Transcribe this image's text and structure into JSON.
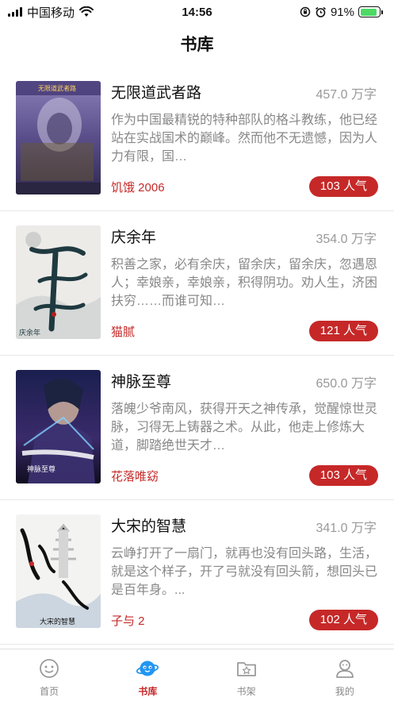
{
  "status_bar": {
    "carrier": "中国移动",
    "time": "14:56",
    "battery": "91%"
  },
  "header": {
    "title": "书库"
  },
  "books": [
    {
      "title": "无限道武者路",
      "words": "457.0 万字",
      "description": "作为中国最精锐的特种部队的格斗教练，他已经站在实战国术的巅峰。然而他不无遗憾，因为人力有限，国…",
      "author": "饥饿 2006",
      "popularity": "103 人气",
      "cover_text": "无限道武者路"
    },
    {
      "title": "庆余年",
      "words": "354.0 万字",
      "description": "积善之家，必有余庆，留余庆，留余庆，忽遇恩人；幸娘亲，幸娘亲，积得阴功。劝人生，济困扶穷……而谁可知…",
      "author": "猫腻",
      "popularity": "121 人气",
      "cover_text": "庆余年"
    },
    {
      "title": "神脉至尊",
      "words": "650.0 万字",
      "description": "落魄少爷南风，获得开天之神传承，觉醒惊世灵脉，习得无上铸器之术。从此，他走上修炼大道，脚踏绝世天才…",
      "author": "花落唯窈",
      "popularity": "103 人气",
      "cover_text": "神脉至尊"
    },
    {
      "title": "大宋的智慧",
      "words": "341.0 万字",
      "description": "云峥打开了一扇门，就再也没有回头路，生活，就是这个样子，开了弓就没有回头箭，想回头已是百年身。...",
      "author": "子与 2",
      "popularity": "102 人气",
      "cover_text": "大宋的智慧"
    }
  ],
  "tabs": [
    {
      "label": "首页",
      "icon": "home-face-icon",
      "active": false
    },
    {
      "label": "书库",
      "icon": "library-planet-icon",
      "active": true
    },
    {
      "label": "书架",
      "icon": "bookshelf-folder-icon",
      "active": false
    },
    {
      "label": "我的",
      "icon": "profile-person-icon",
      "active": false
    }
  ],
  "colors": {
    "accent": "#c62828",
    "author": "#c62a2a",
    "active_tab_icon": "#2196f3"
  }
}
